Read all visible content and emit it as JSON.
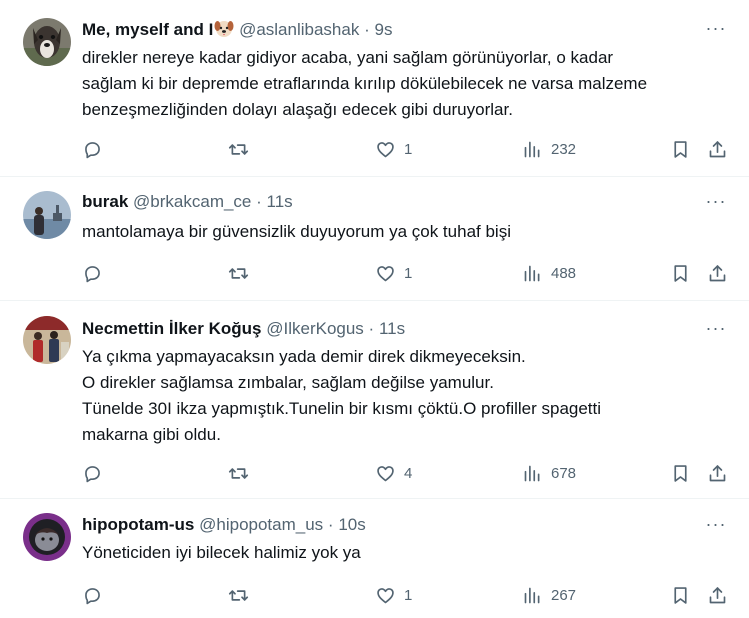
{
  "tweets": [
    {
      "name": "Me, myself and I",
      "name_emoji": "dog-face-emoji",
      "handle": "@aslanlibashak",
      "separator": "·",
      "time": "9s",
      "body_lines": [
        "direkler nereye kadar gidiyor acaba, yani sağlam görünüyorlar, o kadar",
        "sağlam ki bir depremde etraflarında kırılıp dökülebilecek ne varsa malzeme",
        "benzeşmezliğinden dolayı alaşağı edecek gibi duruyorlar."
      ],
      "likes": "1",
      "views": "232"
    },
    {
      "name": "burak",
      "handle": "@brkakcam_ce",
      "separator": "·",
      "time": "11s",
      "body_lines": [
        "mantolamaya bir güvensizlik duyuyorum ya çok tuhaf bişi"
      ],
      "likes": "1",
      "views": "488"
    },
    {
      "name": "Necmettin İlker Koğuş",
      "handle": "@IlkerKogus",
      "separator": "·",
      "time": "11s",
      "body_lines": [
        "Ya çıkma yapmayacaksın yada demir direk dikmeyeceksin.",
        "O direkler sağlamsa zımbalar, sağlam değilse yamulur.",
        "Tünelde 30I ikza yapmıştık.Tunelin bir kısmı çöktü.O profiller spagetti",
        "makarna gibi oldu."
      ],
      "likes": "4",
      "views": "678"
    },
    {
      "name": "hipopotam-us",
      "handle": "@hipopotam_us",
      "separator": "·",
      "time": "10s",
      "body_lines": [
        "Yöneticiden iyi bilecek halimiz yok ya"
      ],
      "likes": "1",
      "views": "267"
    }
  ],
  "icons": {
    "more": "more-horizontal-icon",
    "reply": "reply-icon",
    "retweet": "retweet-icon",
    "like": "heart-icon",
    "views": "analytics-icon",
    "bookmark": "bookmark-icon",
    "share": "share-icon"
  },
  "colors": {
    "text": "#0f1419",
    "secondary": "#536471",
    "divider": "#eff3f4"
  }
}
